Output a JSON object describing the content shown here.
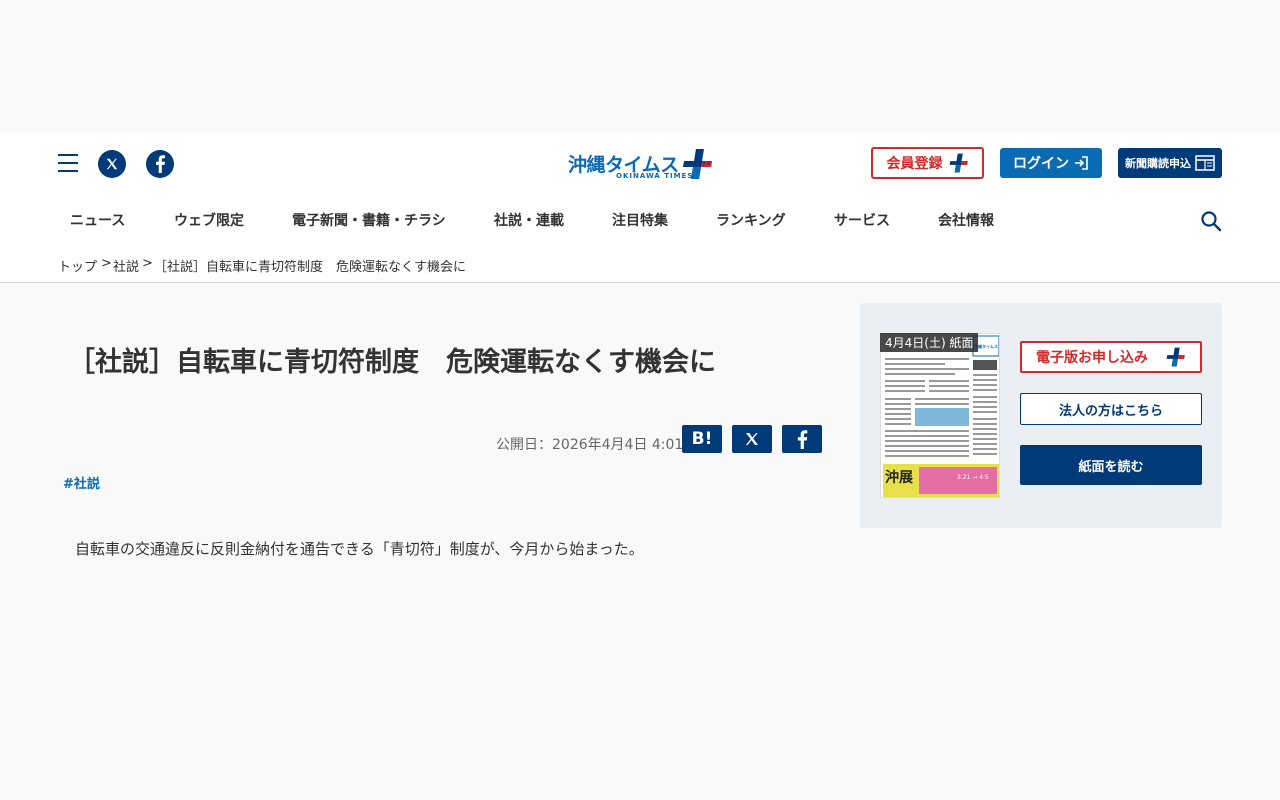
{
  "header": {
    "logo_text": "沖縄タイムス",
    "logo_sub": "OKINAWA TIMES",
    "plus_badge": "プラス",
    "member_label": "会員登録",
    "login_label": "ログイン",
    "subscribe_label": "新聞購読申込"
  },
  "nav": {
    "items": [
      "ニュース",
      "ウェブ限定",
      "電子新聞・書籍・チラシ",
      "社説・連載",
      "注目特集",
      "ランキング",
      "サービス",
      "会社情報"
    ]
  },
  "breadcrumb": {
    "top": "トップ",
    "category": "社説",
    "current": "［社説］自転車に青切符制度　危険運転なくす機会に",
    "separator": ">"
  },
  "article": {
    "title": "［社説］自転車に青切符制度　危険運転なくす機会に",
    "published": "公開日：2026年4月4日 4:01",
    "share_hatena": "B!",
    "tag": "#社説",
    "body_first_line": "自転車の交通違反に反則金納付を通告できる「青切符」制度が、今月から始まった。"
  },
  "sidebar": {
    "paper_label": "4月4日(土) 紙面",
    "paper_masthead": "沖縄タイムス",
    "paper_ad_text": "沖展",
    "paper_ad_dates": "3.21 → 4.5",
    "digital_apply": "電子版お申し込み",
    "corporate": "法人の方はこちら",
    "read_paper": "紙面を読む"
  },
  "colors": {
    "navy": "#003a78",
    "blue": "#0a6ab2",
    "red": "#d62828",
    "panel": "#ebeff4"
  }
}
